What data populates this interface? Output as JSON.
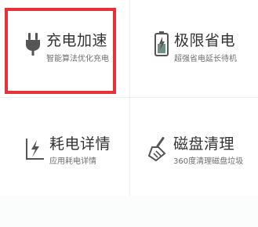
{
  "colors": {
    "selection": "#e53137",
    "icon": "#555555",
    "accent": "#6f8f7f"
  },
  "tiles": [
    {
      "title": "充电加速",
      "subtitle": "智能算法优化充电",
      "icon": "plug-icon"
    },
    {
      "title": "极限省电",
      "subtitle": "超强省电延长待机",
      "icon": "battery-icon"
    },
    {
      "title": "耗电详情",
      "subtitle": "应用耗电详情",
      "icon": "power-chart-icon"
    },
    {
      "title": "磁盘清理",
      "subtitle": "360度清理磁盘垃圾",
      "icon": "broom-icon"
    }
  ]
}
